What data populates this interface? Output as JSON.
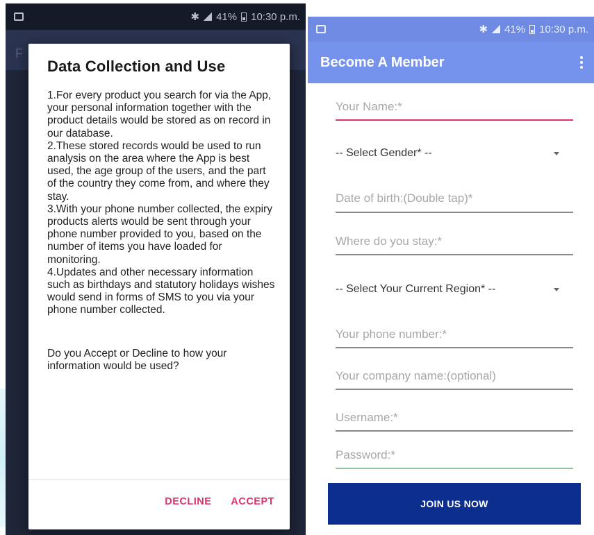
{
  "status_bar": {
    "battery": "41%",
    "time": "10:30 p.m."
  },
  "left_app_bar_letter": "F",
  "dialog": {
    "title": "Data Collection and Use",
    "paragraphs": [
      "1.For every product you search for via the App, your personal information together with the product details would be stored as on record in our database.",
      "2.These stored records would be used to run analysis on the area where the App is best used, the age group of the users, and the part of the country they come from, and where they stay.",
      "3.With your phone number collected, the expiry products alerts would be sent through your phone number provided to you, based on the number of items you have loaded for monitoring.",
      "4.Updates and other necessary information such as birthdays and statutory holidays wishes would send in forms of SMS to you via your phone number collected."
    ],
    "question": "Do you Accept or Decline to how your information would be used?",
    "decline_label": "DECLINE",
    "accept_label": "ACCEPT",
    "accent_color": "#e0306a"
  },
  "register": {
    "title": "Become A Member",
    "name_placeholder": "Your Name:*",
    "gender_select": "-- Select Gender* --",
    "dob_placeholder": "Date of birth:(Double tap)*",
    "stay_placeholder": "Where do you stay:*",
    "region_select": "-- Select Your Current Region* --",
    "phone_placeholder": "Your phone number:*",
    "company_placeholder": "Your company name:(optional)",
    "username_placeholder": "Username:*",
    "password_placeholder": "Password:*",
    "join_label": "JOIN US NOW",
    "appbar_color": "#7592ec",
    "button_color": "#0b2e8f"
  }
}
